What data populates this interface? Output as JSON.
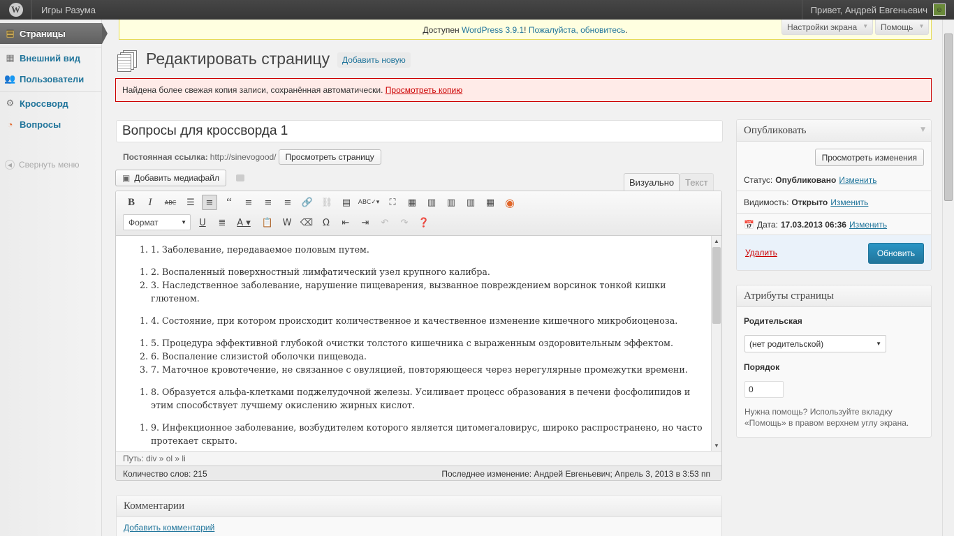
{
  "adminbar": {
    "site_name": "Игры Разума",
    "greeting": "Привет, Андрей Евгеньевич"
  },
  "menu": {
    "items": [
      {
        "label": "Страницы",
        "icon": "pages-icon",
        "current": true
      },
      {
        "label": "Внешний вид",
        "icon": "appearance-icon"
      },
      {
        "label": "Пользователи",
        "icon": "users-icon"
      },
      {
        "label": "Кроссворд",
        "icon": "crossword-icon"
      },
      {
        "label": "Вопросы",
        "icon": "questions-icon"
      }
    ],
    "collapse_label": "Свернуть меню"
  },
  "notice": {
    "prefix": "Доступен ",
    "link1": "WordPress 3.9.1",
    "middle": "! ",
    "link2": "Пожалуйста, обновитесь",
    "suffix": "."
  },
  "screen_options": {
    "label": "Настройки экрана"
  },
  "help_tab": {
    "label": "Помощь"
  },
  "page": {
    "title": "Редактировать страницу",
    "add_new": "Добавить новую"
  },
  "autosave": {
    "message": "Найдена более свежая копия записи, сохранённая автоматически. ",
    "link": "Просмотреть копию"
  },
  "post": {
    "title": "Вопросы для кроссворда 1",
    "permalink_label": "Постоянная ссылка:",
    "permalink_url": "http://sinevogood/",
    "view_page": "Просмотреть страницу"
  },
  "editor": {
    "add_media": "Добавить медиафайл",
    "tab_visual": "Визуально",
    "tab_text": "Текст",
    "format_select": "Формат",
    "content": [
      [
        "1. Заболевание, передаваемое половым путем."
      ],
      [
        "2. Воспаленный поверхностный лимфатический узел крупного калибра.",
        "3. Наследственное заболевание, нарушение пищеварения, вызванное повреждением ворсинок тонкой кишки глютеном."
      ],
      [
        "4. Состояние, при котором происходит количественное и качественное изменение кишечного микробиоценоза."
      ],
      [
        "5. Процедура эффективной глубокой очистки толстого кишечника с выраженным оздоровительным эффектом.",
        "6. Воспаление слизистой оболочки пищевода.",
        "7. Маточное кровотечение, не связанное с овуляцией, повторяющееся через нерегулярные промежутки времени."
      ],
      [
        "8. Образуется альфа-клетками поджелудочной железы. Усиливает процесс образования в печени фосфолипидов и этим способствует лучшему окислению жирных кислот."
      ],
      [
        "9. Инфекционное заболевание, возбудителем которого является цитомегаловирус, широко распространено, но часто протекает скрыто."
      ]
    ],
    "path": "Путь: div » ol » li",
    "word_count": "Количество слов: 215",
    "last_edit": "Последнее изменение: Андрей Евгеньевич; Апрель 3, 2013 в 3:53 пп"
  },
  "publish": {
    "title": "Опубликовать",
    "preview": "Просмотреть изменения",
    "status_label": "Статус:",
    "status_value": "Опубликовано",
    "visibility_label": "Видимость:",
    "visibility_value": "Открыто",
    "date_label": "Дата:",
    "date_value": "17.03.2013 06:36",
    "edit": "Изменить",
    "delete": "Удалить",
    "update": "Обновить"
  },
  "attributes": {
    "title": "Атрибуты страницы",
    "parent_label": "Родительская",
    "parent_value": "(нет родительской)",
    "order_label": "Порядок",
    "order_value": "0",
    "help": "Нужна помощь? Используйте вкладку «Помощь» в правом верхнем углу экрана."
  },
  "comments": {
    "title": "Комментарии",
    "add": "Добавить комментарий"
  }
}
